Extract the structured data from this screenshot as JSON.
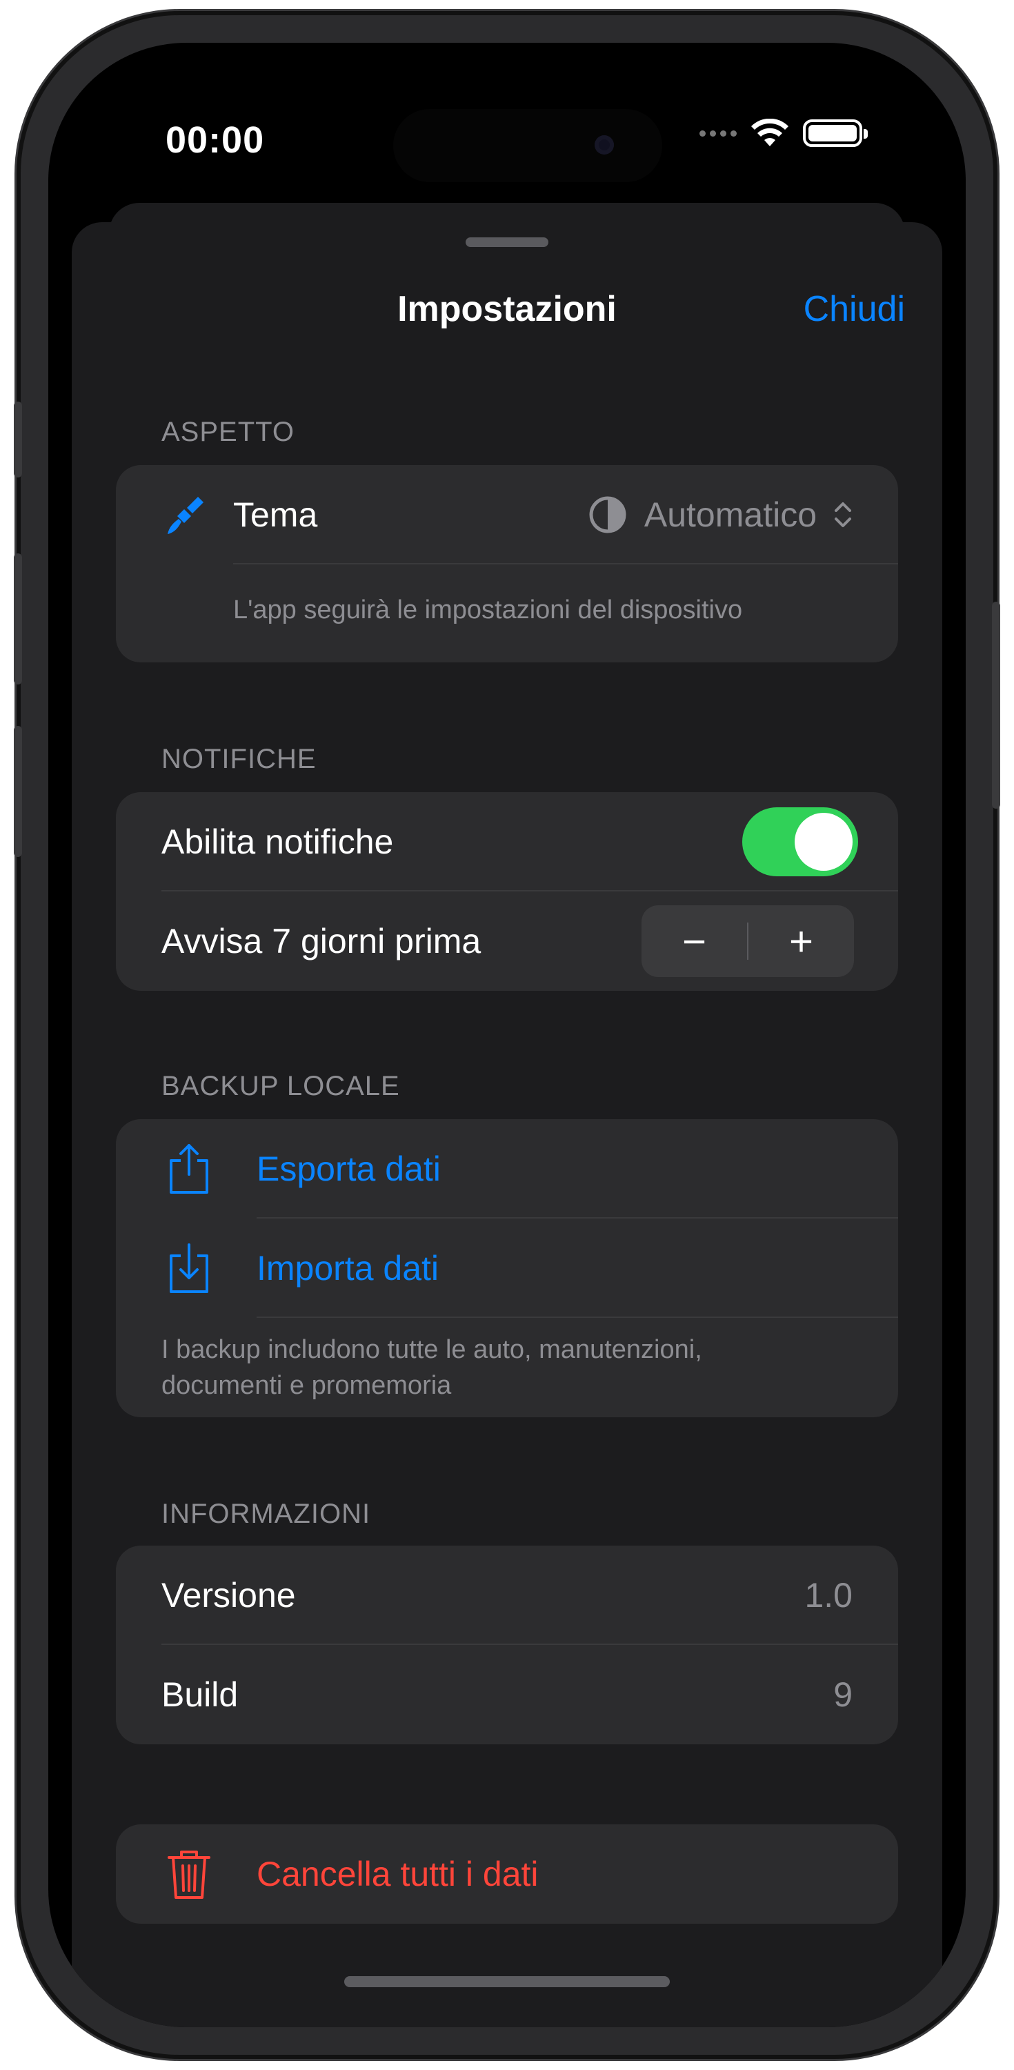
{
  "status_bar": {
    "time": "00:00"
  },
  "nav": {
    "title": "Impostazioni",
    "close_label": "Chiudi"
  },
  "appearance": {
    "header": "ASPETTO",
    "theme_label": "Tema",
    "theme_value": "Automatico",
    "theme_note": "L'app seguirà le impostazioni del dispositivo"
  },
  "notifications": {
    "header": "NOTIFICHE",
    "enable_label": "Abilita notifiche",
    "enabled": true,
    "remind_label": "Avvisa 7 giorni prima",
    "minus": "−",
    "plus": "+"
  },
  "backup": {
    "header": "BACKUP LOCALE",
    "export_label": "Esporta dati",
    "import_label": "Importa dati",
    "note": "I backup includono tutte le auto, manutenzioni, documenti e promemoria"
  },
  "info": {
    "header": "INFORMAZIONI",
    "version_label": "Versione",
    "version_value": "1.0",
    "build_label": "Build",
    "build_value": "9"
  },
  "danger": {
    "delete_label": "Cancella tutti i dati"
  },
  "colors": {
    "accent": "#0a84ff",
    "destructive": "#ff453a",
    "toggle_on": "#30d158"
  },
  "icons": [
    "paintbrush-icon",
    "half-circle-icon",
    "chevron-up-down-icon",
    "share-export-icon",
    "import-tray-icon",
    "trash-icon"
  ]
}
